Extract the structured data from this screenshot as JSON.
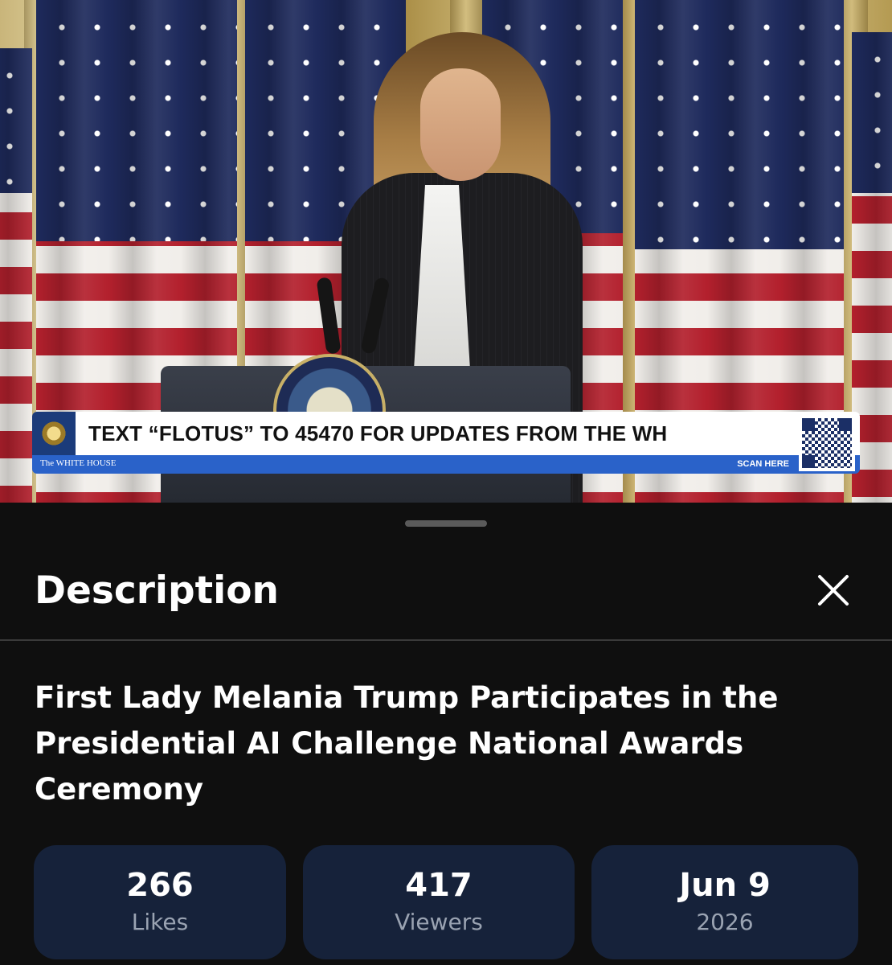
{
  "video": {
    "banner": {
      "text": "TEXT “FLOTUS” TO 45470 FOR UPDATES FROM THE WH",
      "org": "The WHITE HOUSE",
      "scan_label": "SCAN HERE"
    }
  },
  "sheet": {
    "header": "Description",
    "close_icon": "close-icon",
    "video_title": "First Lady Melania Trump Participates in the Presidential AI Challenge National Awards Ceremony",
    "stats": [
      {
        "value": "266",
        "label": "Likes"
      },
      {
        "value": "417",
        "label": "Viewers"
      },
      {
        "value": "Jun 9",
        "label": "2026"
      }
    ]
  },
  "colors": {
    "sheet_bg": "#0f0f0f",
    "stat_card_bg": "#16223a",
    "banner_blue": "#2a62c9",
    "stat_label": "#9aa3b2"
  }
}
